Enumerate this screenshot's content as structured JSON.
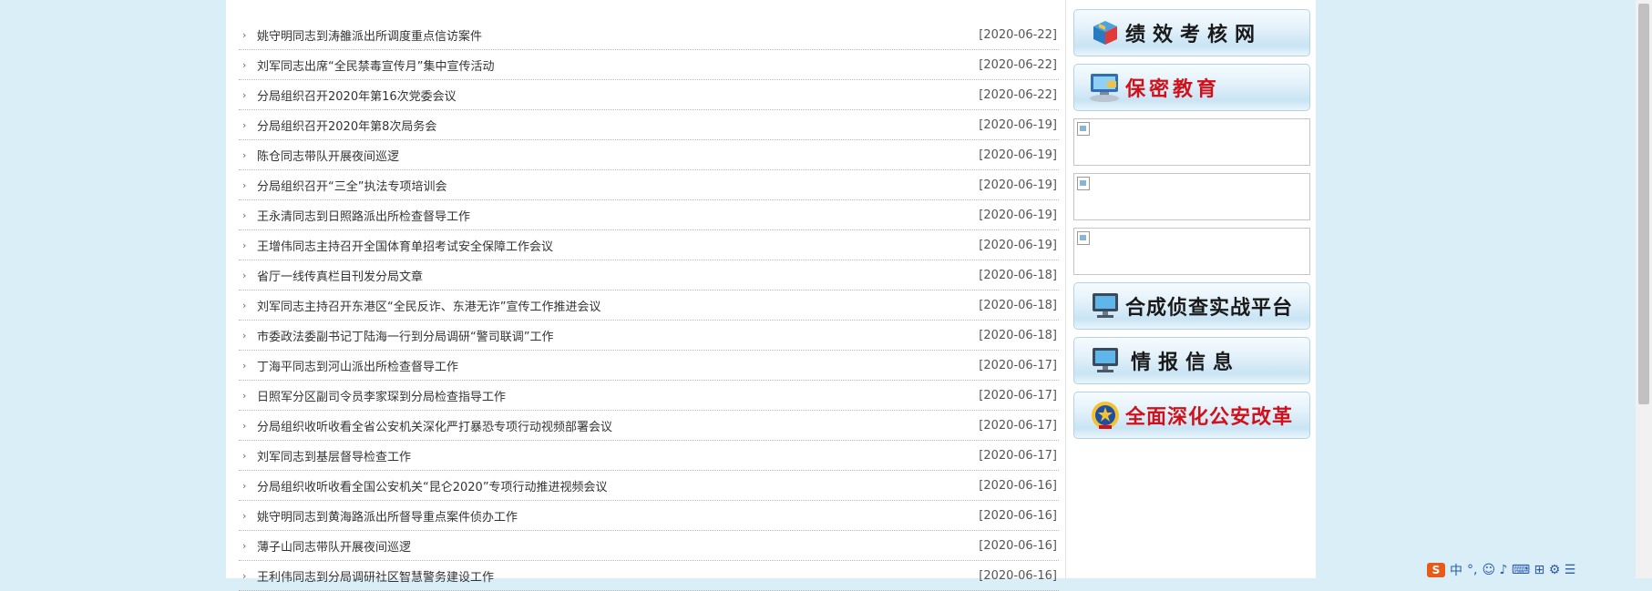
{
  "news": [
    {
      "title": "姚守明同志到涛雒派出所调度重点信访案件",
      "date": "[2020-06-22]"
    },
    {
      "title": "刘军同志出席“全民禁毒宣传月”集中宣传活动",
      "date": "[2020-06-22]"
    },
    {
      "title": "分局组织召开2020年第16次党委会议",
      "date": "[2020-06-22]"
    },
    {
      "title": "分局组织召开2020年第8次局务会",
      "date": "[2020-06-19]"
    },
    {
      "title": "陈仓同志带队开展夜间巡逻",
      "date": "[2020-06-19]"
    },
    {
      "title": "分局组织召开“三全”执法专项培训会",
      "date": "[2020-06-19]"
    },
    {
      "title": "王永清同志到日照路派出所检查督导工作",
      "date": "[2020-06-19]"
    },
    {
      "title": "王增伟同志主持召开全国体育单招考试安全保障工作会议",
      "date": "[2020-06-19]"
    },
    {
      "title": "省厅一线传真栏目刊发分局文章",
      "date": "[2020-06-18]"
    },
    {
      "title": "刘军同志主持召开东港区“全民反诈、东港无诈”宣传工作推进会议",
      "date": "[2020-06-18]"
    },
    {
      "title": "市委政法委副书记丁陆海一行到分局调研“警司联调”工作",
      "date": "[2020-06-18]"
    },
    {
      "title": "丁海平同志到河山派出所检查督导工作",
      "date": "[2020-06-17]"
    },
    {
      "title": "日照军分区副司令员李家琛到分局检查指导工作",
      "date": "[2020-06-17]"
    },
    {
      "title": "分局组织收听收看全省公安机关深化严打暴恐专项行动视频部署会议",
      "date": "[2020-06-17]"
    },
    {
      "title": "刘军同志到基层督导检查工作",
      "date": "[2020-06-17]"
    },
    {
      "title": "分局组织收听收看全国公安机关“昆仑2020”专项行动推进视频会议",
      "date": "[2020-06-16]"
    },
    {
      "title": "姚守明同志到黄海路派出所督导重点案件侦办工作",
      "date": "[2020-06-16]"
    },
    {
      "title": "薄子山同志带队开展夜间巡逻",
      "date": "[2020-06-16]"
    },
    {
      "title": "王利伟同志到分局调研社区智慧警务建设工作",
      "date": "[2020-06-16]"
    }
  ],
  "sidebar": {
    "banner1": {
      "label": "绩效考核网",
      "color": "#1a1a1a",
      "icon": "cube-icon"
    },
    "banner2": {
      "label": "保密教育",
      "color": "#d0111b",
      "icon": "computer-icon"
    },
    "banner3": {
      "label": "合成侦查实战平台",
      "color": "#1a1a1a",
      "icon": "monitor-icon"
    },
    "banner4": {
      "label": "情报信息",
      "color": "#1a1a1a",
      "icon": "monitor-icon"
    },
    "banner5": {
      "label": "全面深化公安改革",
      "color": "#d0111b",
      "icon": "police-emblem-icon"
    }
  },
  "ime": {
    "logo": "S",
    "mode": "中",
    "punct": "°,",
    "extra": "☺ ♪ ⌨ ⊞ ⚙ ☰"
  }
}
